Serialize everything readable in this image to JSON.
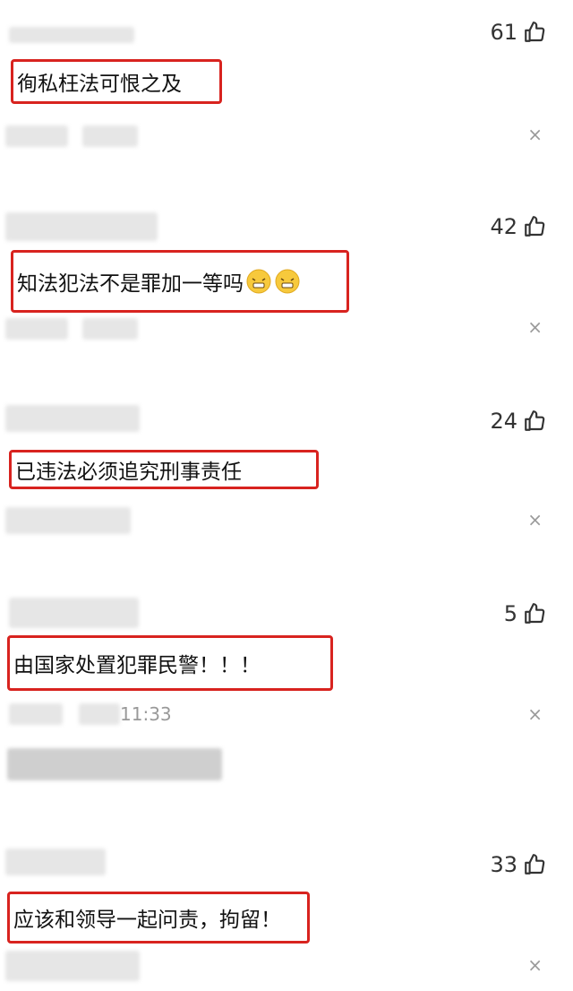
{
  "comments": [
    {
      "likes": "61",
      "text": "徇私枉法可恨之及",
      "emoji_icons": []
    },
    {
      "likes": "42",
      "text": "知法犯法不是罪加一等吗",
      "emoji_icons": [
        "grimace-emoji-icon",
        "grimace-emoji-icon"
      ]
    },
    {
      "likes": "24",
      "text": "已违法必须追究刑事责任",
      "emoji_icons": []
    },
    {
      "likes": "5",
      "text": "由国家处置犯罪民警！！！",
      "time": "11:33",
      "emoji_icons": []
    },
    {
      "likes": "33",
      "text": "应该和领导一起问责，拘留！",
      "emoji_icons": []
    }
  ],
  "close_symbol": "×",
  "colors": {
    "highlight_box": "#d8231f",
    "text": "#111111",
    "muted": "#999999",
    "blur": "#e6e6e6"
  }
}
